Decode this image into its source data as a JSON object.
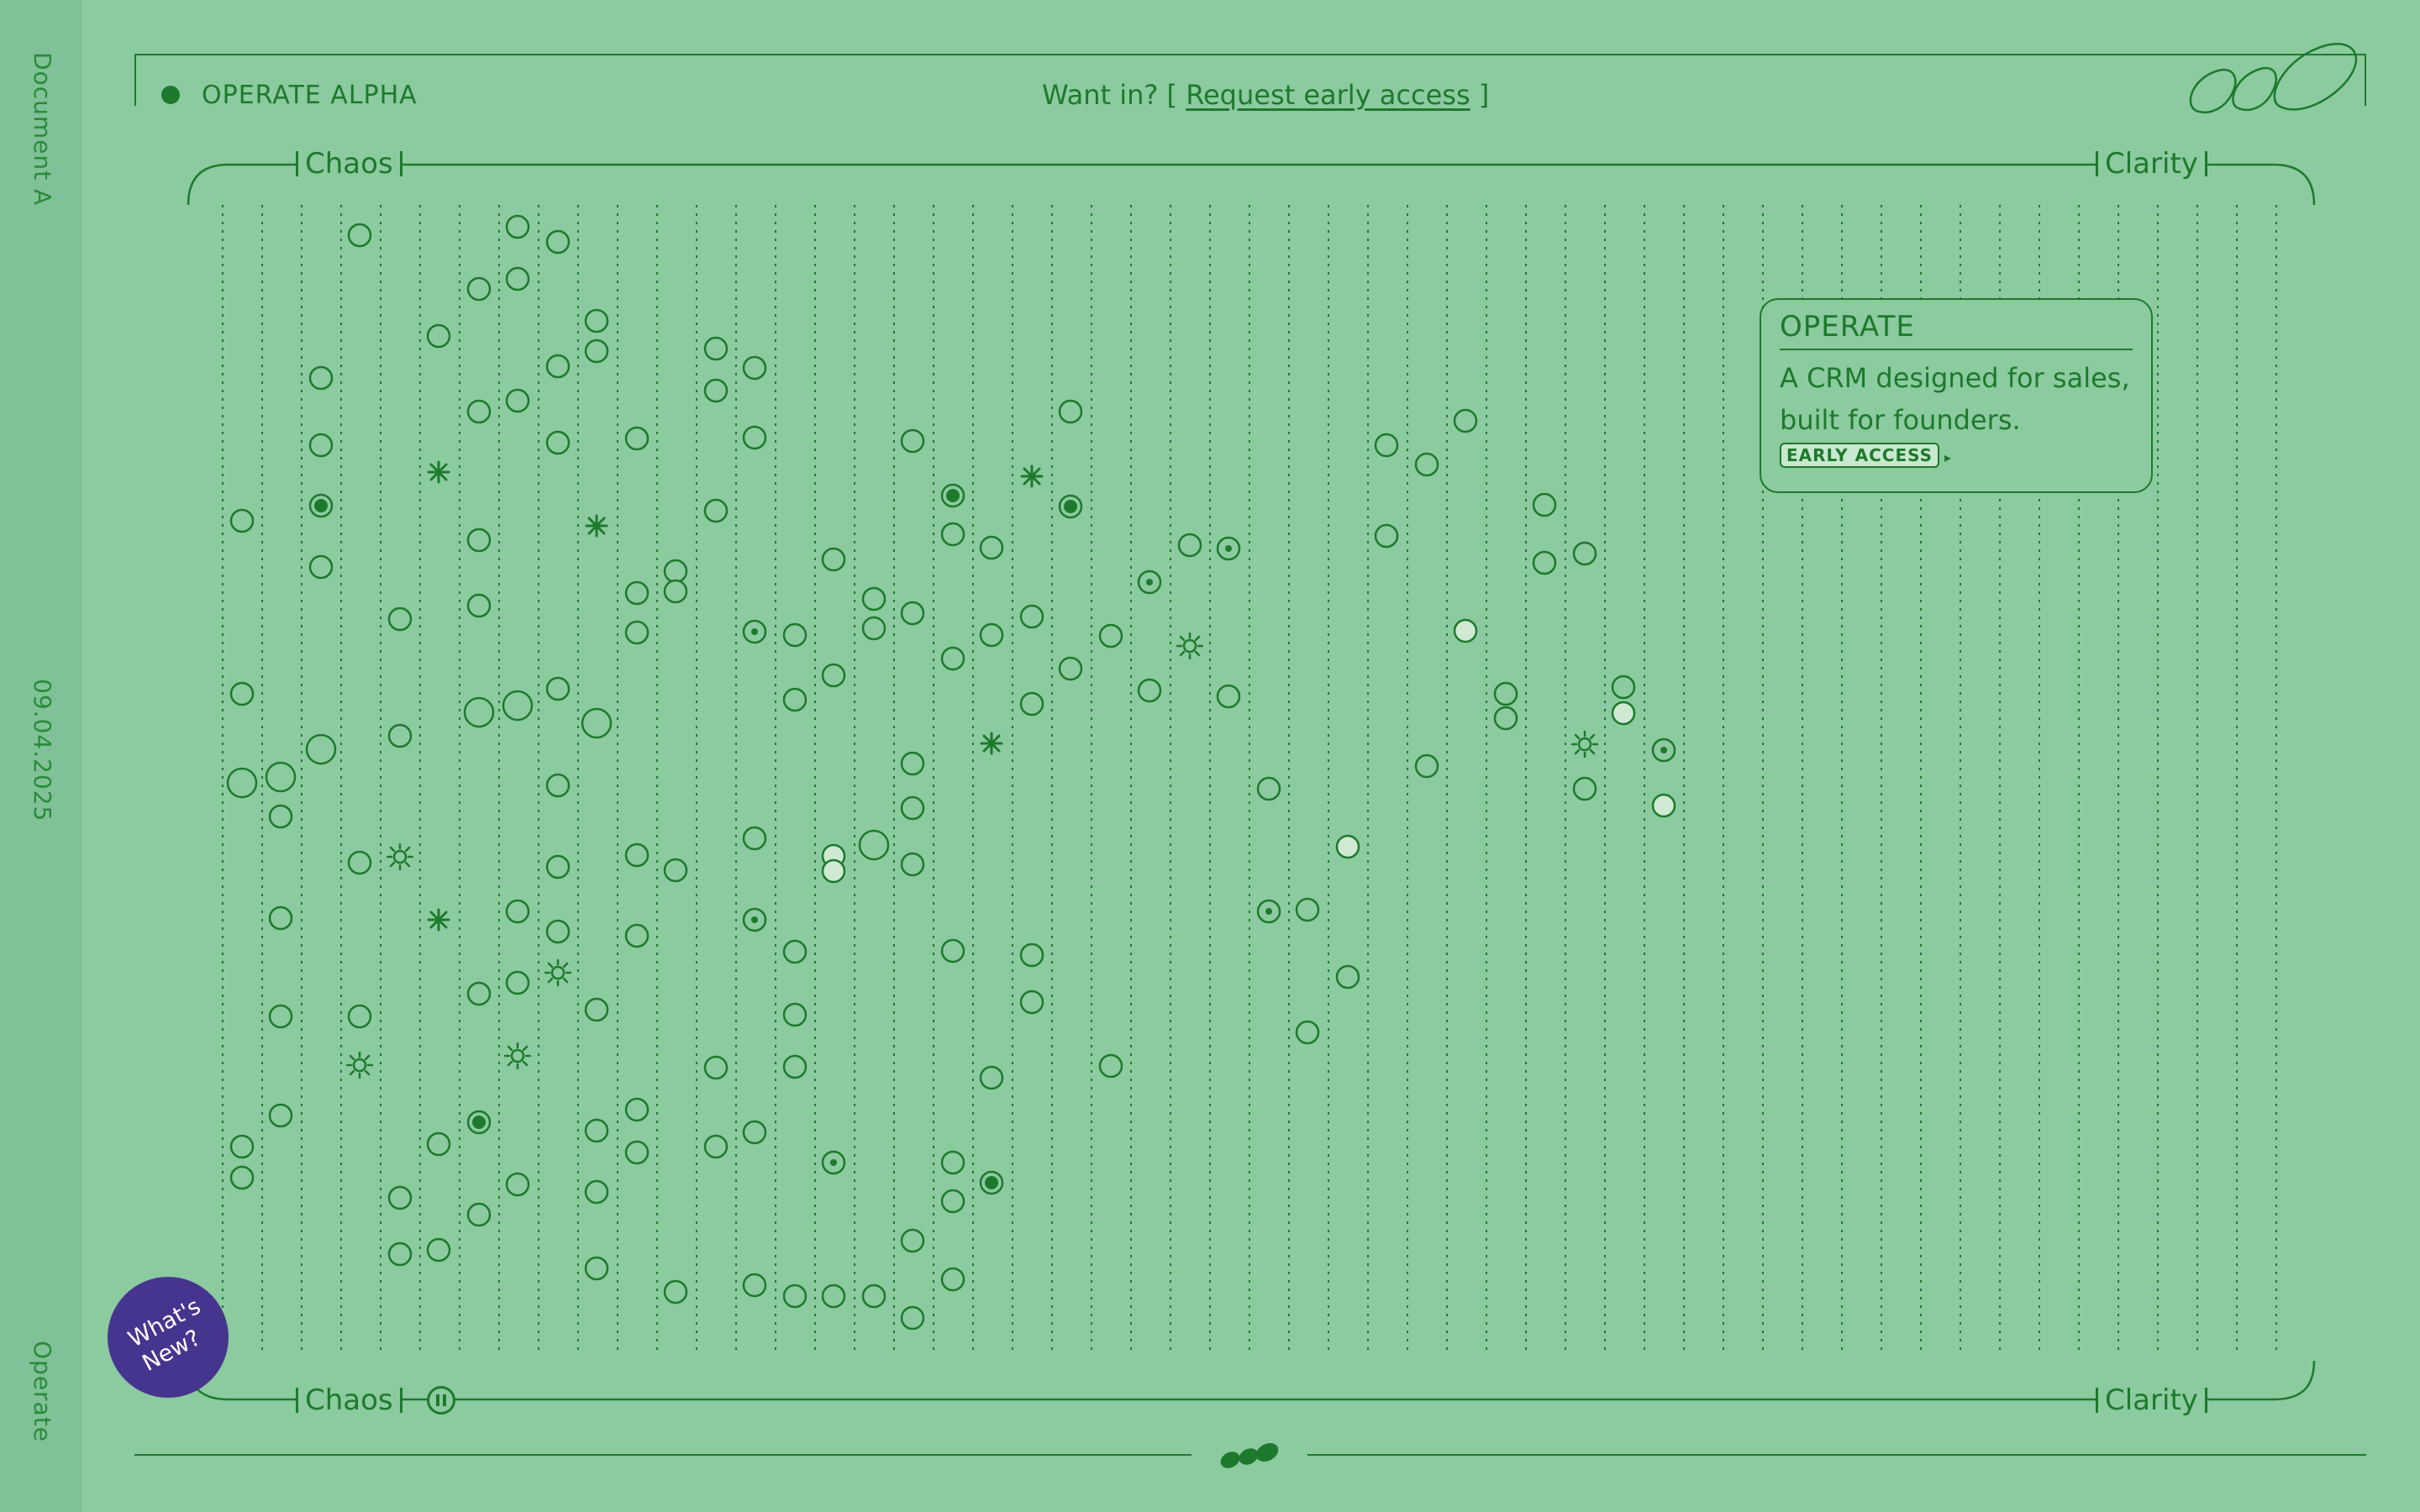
{
  "rail": {
    "top_label": "Document A",
    "date": "09.04.2025",
    "bottom_label": "Operate"
  },
  "header": {
    "brand": "OPERATE ALPHA",
    "cta_prefix": "Want in? [ ",
    "cta_link": "Request early access",
    "cta_suffix": " ]"
  },
  "axis": {
    "left_label": "Chaos",
    "right_label": "Clarity"
  },
  "card": {
    "title": "OPERATE",
    "body_line1": "A CRM designed for sales,",
    "body_line2": "built for founders.",
    "link": "EARLY ACCESS"
  },
  "whats_new": {
    "line1": "What's",
    "line2": "New?"
  },
  "colors": {
    "background": "#8ccaa0",
    "ink": "#1d7a2c",
    "badge": "#46358f",
    "light_fill": "#cfe9d3"
  },
  "icons": {
    "status": "status-dot-icon",
    "logo": "operate-logo-icon",
    "pause": "pause-icon",
    "arrow": "arrow-right-icon"
  }
}
